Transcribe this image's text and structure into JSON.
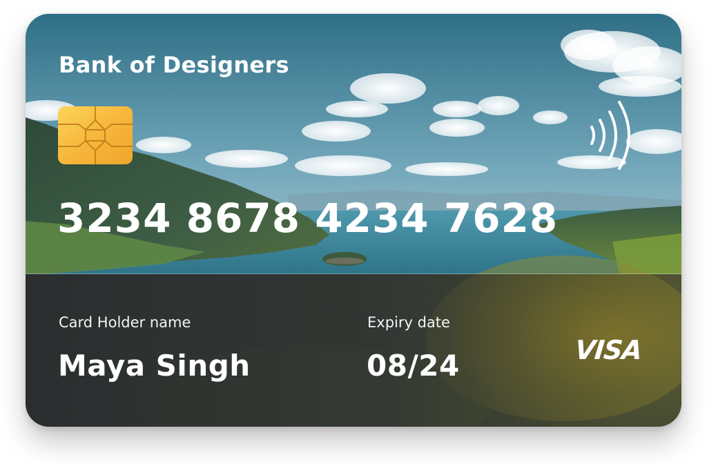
{
  "card": {
    "bank_name": "Bank of Designers",
    "number": "3234 8678 4234 7628",
    "holder_label": "Card Holder name",
    "holder_name": "Maya Singh",
    "expiry_label": "Expiry date",
    "expiry_value": "08/24",
    "brand": "VISA"
  },
  "icons": {
    "chip": "emv-chip-icon",
    "contactless": "contactless-icon"
  },
  "colors": {
    "chip_gold": "#f6b73c",
    "text": "#ffffff",
    "water": "#3e8aa0",
    "sky": "#a9cbd8"
  }
}
